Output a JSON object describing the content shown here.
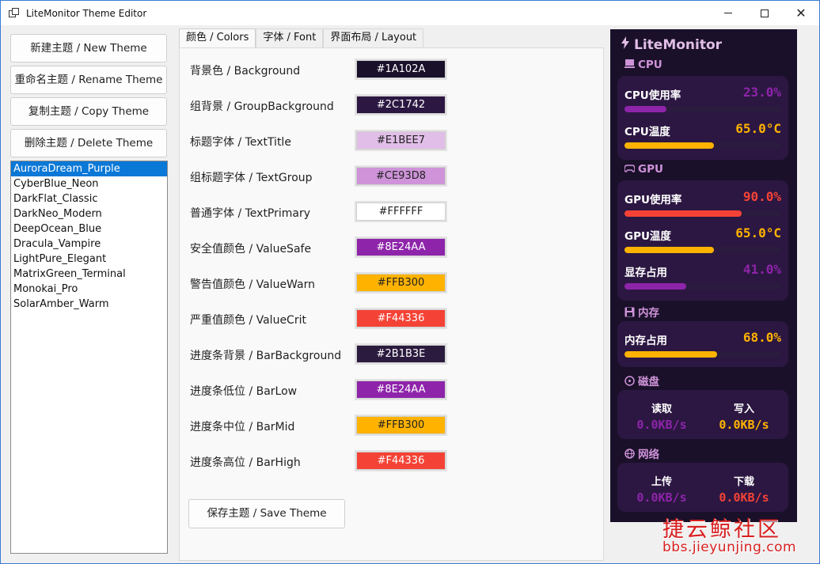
{
  "window": {
    "title": "LiteMonitor Theme Editor",
    "minimize_glyph": "",
    "close_glyph": "✕"
  },
  "actions": {
    "new_theme": "新建主题 / New Theme",
    "rename_theme": "重命名主题 / Rename Theme",
    "copy_theme": "复制主题 / Copy Theme",
    "delete_theme": "删除主题 / Delete Theme"
  },
  "themes": {
    "selected": "AuroraDream_Purple",
    "items": [
      "AuroraDream_Purple",
      "CyberBlue_Neon",
      "DarkFlat_Classic",
      "DarkNeo_Modern",
      "DeepOcean_Blue",
      "Dracula_Vampire",
      "LightPure_Elegant",
      "MatrixGreen_Terminal",
      "Monokai_Pro",
      "SolarAmber_Warm"
    ]
  },
  "tabs": [
    {
      "label": "颜色 / Colors",
      "active": true
    },
    {
      "label": "字体 / Font",
      "active": false
    },
    {
      "label": "界面布局 / Layout",
      "active": false
    }
  ],
  "colors": [
    {
      "label": "背景色 / Background",
      "value": "#1A102A",
      "text_color": "#ffffff"
    },
    {
      "label": "组背景 / GroupBackground",
      "value": "#2C1742",
      "text_color": "#ffffff"
    },
    {
      "label": "标题字体 / TextTitle",
      "value": "#E1BEE7",
      "text_color": "#222222"
    },
    {
      "label": "组标题字体 / TextGroup",
      "value": "#CE93D8",
      "text_color": "#222222"
    },
    {
      "label": "普通字体 / TextPrimary",
      "value": "#FFFFFF",
      "text_color": "#222222"
    },
    {
      "label": "安全值颜色 / ValueSafe",
      "value": "#8E24AA",
      "text_color": "#ffffff"
    },
    {
      "label": "警告值颜色 / ValueWarn",
      "value": "#FFB300",
      "text_color": "#222222"
    },
    {
      "label": "严重值颜色 / ValueCrit",
      "value": "#F44336",
      "text_color": "#ffffff"
    },
    {
      "label": "进度条背景 / BarBackground",
      "value": "#2B1B3E",
      "text_color": "#ffffff"
    },
    {
      "label": "进度条低位 / BarLow",
      "value": "#8E24AA",
      "text_color": "#ffffff"
    },
    {
      "label": "进度条中位 / BarMid",
      "value": "#FFB300",
      "text_color": "#222222"
    },
    {
      "label": "进度条高位 / BarHigh",
      "value": "#F44336",
      "text_color": "#ffffff"
    }
  ],
  "save_button": "保存主题 / Save Theme",
  "preview": {
    "title": "LiteMonitor",
    "groups": {
      "cpu": "CPU",
      "gpu": "GPU",
      "mem": "内存",
      "disk": "磁盘",
      "net": "网络"
    },
    "metrics": {
      "cpu_usage": {
        "label": "CPU使用率",
        "value": "23.0%",
        "fill": 0.23,
        "color": "#8E24AA"
      },
      "cpu_temp": {
        "label": "CPU温度",
        "value": "65.0°C",
        "fill": 0.65,
        "color": "#FFB300"
      },
      "gpu_usage": {
        "label": "GPU使用率",
        "value": "90.0%",
        "fill": 0.9,
        "color": "#F44336"
      },
      "gpu_temp": {
        "label": "GPU温度",
        "value": "65.0°C",
        "fill": 0.65,
        "color": "#FFB300"
      },
      "vram": {
        "label": "显存占用",
        "value": "41.0%",
        "fill": 0.41,
        "color": "#8E24AA"
      },
      "mem_usage": {
        "label": "内存占用",
        "value": "68.0%",
        "fill": 0.68,
        "color": "#FFB300"
      }
    },
    "disk": {
      "read_label": "读取",
      "read_value": "0.0KB/s",
      "write_label": "写入",
      "write_value": "0.0KB/s"
    },
    "net": {
      "up_label": "上传",
      "up_value": "0.0KB/s",
      "down_label": "下载",
      "down_value": "0.0KB/s"
    }
  },
  "watermark": {
    "cn": "捷云鲸社区",
    "url": "bbs.jieyunjing.com"
  }
}
